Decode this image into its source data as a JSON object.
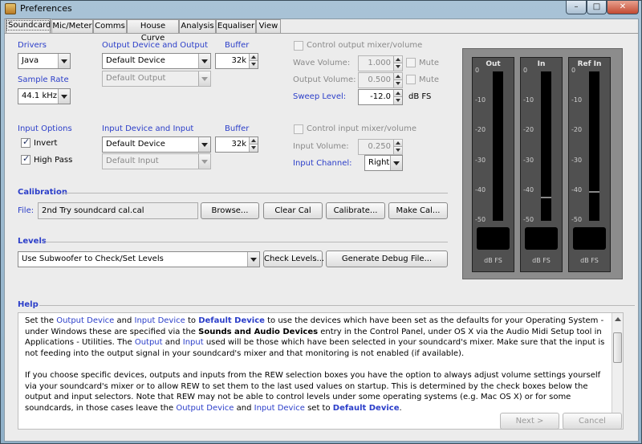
{
  "window": {
    "title": "Preferences"
  },
  "tabs": [
    "Soundcard",
    "Mic/Meter",
    "Comms",
    "House Curve",
    "Analysis",
    "Equaliser",
    "View"
  ],
  "drivers": {
    "label": "Drivers",
    "value": "Java"
  },
  "sample_rate": {
    "label": "Sample Rate",
    "value": "44.1 kHz"
  },
  "output": {
    "label": "Output Device and Output",
    "device": "Default Device",
    "channel": "Default Output",
    "buffer_label": "Buffer",
    "buffer": "32k"
  },
  "input_options": {
    "label": "Input Options",
    "invert": "Invert",
    "high_pass": "High Pass"
  },
  "input": {
    "label": "Input Device and Input",
    "device": "Default Device",
    "channel": "Default Input",
    "buffer_label": "Buffer",
    "buffer": "32k"
  },
  "output_mixer": {
    "checkbox": "Control output mixer/volume",
    "wave_label": "Wave Volume:",
    "wave": "1.000",
    "mute1": "Mute",
    "out_label": "Output Volume:",
    "out": "0.500",
    "mute2": "Mute",
    "sweep_label": "Sweep Level:",
    "sweep": "-12.0",
    "sweep_unit": "dB FS"
  },
  "input_mixer": {
    "checkbox": "Control input mixer/volume",
    "vol_label": "Input Volume:",
    "vol": "0.250",
    "channel_label": "Input Channel:",
    "channel": "Right"
  },
  "calibration": {
    "heading": "Calibration",
    "file_label": "File:",
    "file": "2nd Try soundcard cal.cal",
    "browse": "Browse...",
    "clear": "Clear Cal",
    "calibrate": "Calibrate...",
    "make": "Make Cal..."
  },
  "levels": {
    "heading": "Levels",
    "mode": "Use Subwoofer to Check/Set Levels",
    "check": "Check Levels...",
    "debug": "Generate Debug File..."
  },
  "meters": {
    "ticks": [
      "0",
      "-10",
      "-20",
      "-30",
      "-40",
      "-50"
    ],
    "unit": "dB FS",
    "items": [
      {
        "name": "Out",
        "peak_db": null
      },
      {
        "name": "In",
        "peak_db": -42
      },
      {
        "name": "Ref In",
        "peak_db": -40
      }
    ]
  },
  "help": {
    "heading": "Help",
    "p1": [
      {
        "t": "Set the ",
        "s": ""
      },
      {
        "t": "Output Device",
        "s": "l"
      },
      {
        "t": " and ",
        "s": ""
      },
      {
        "t": "Input Device",
        "s": "l"
      },
      {
        "t": " to ",
        "s": ""
      },
      {
        "t": "Default Device",
        "s": "kb"
      },
      {
        "t": " to use the devices which have been set as the defaults for your Operating System - under Windows these are specified via the ",
        "s": ""
      },
      {
        "t": "Sounds and Audio Devices",
        "s": "k"
      },
      {
        "t": " entry in the Control Panel, under OS X via the Audio Midi Setup tool in Applications - Utilities. The ",
        "s": ""
      },
      {
        "t": "Output",
        "s": "l"
      },
      {
        "t": " and ",
        "s": ""
      },
      {
        "t": "Input",
        "s": "l"
      },
      {
        "t": " used will be those which have been selected in your soundcard's mixer. Make sure that the input is not feeding into the output signal in your soundcard's mixer and that monitoring is not enabled (if available).",
        "s": ""
      }
    ],
    "p2": [
      {
        "t": "If you choose specific devices, outputs and inputs from the REW selection boxes you have the option to always adjust volume settings yourself via your soundcard's mixer or to allow REW to set them to the last used values on startup. This is determined by the check boxes below the output and input selectors. Note that REW may not be able to control levels under some operating systems (e.g. Mac OS X) or for some soundcards, in those cases leave the ",
        "s": ""
      },
      {
        "t": "Output Device",
        "s": "l"
      },
      {
        "t": " and ",
        "s": ""
      },
      {
        "t": "Input Device",
        "s": "l"
      },
      {
        "t": " set to ",
        "s": ""
      },
      {
        "t": "Default Device",
        "s": "kb"
      },
      {
        "t": ".",
        "s": ""
      }
    ]
  },
  "footer": {
    "next": "Next >",
    "cancel": "Cancel"
  },
  "colors": {
    "label_blue": "#2b3ec9",
    "meter_bg": "#505050",
    "panel_bg": "#ececec"
  }
}
